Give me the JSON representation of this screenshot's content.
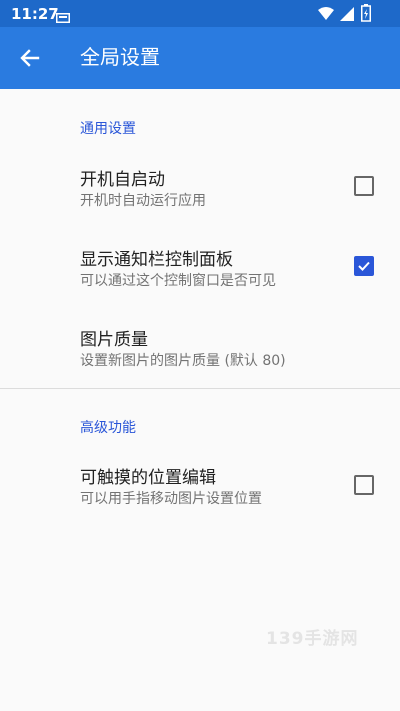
{
  "status_bar": {
    "time": "11:27",
    "icons": [
      "notification-icon",
      "wifi-icon",
      "signal-icon",
      "battery-icon"
    ]
  },
  "app_bar": {
    "title": "全局设置",
    "back_icon": "arrow-left-icon"
  },
  "sections": [
    {
      "header": "通用设置",
      "items": [
        {
          "title": "开机自启动",
          "summary": "开机时自动运行应用",
          "checked": false
        },
        {
          "title": "显示通知栏控制面板",
          "summary": "可以通过这个控制窗口是否可见",
          "checked": true
        },
        {
          "title": "图片质量",
          "summary": "设置新图片的图片质量 (默认 80)"
        }
      ]
    },
    {
      "header": "高级功能",
      "items": [
        {
          "title": "可触摸的位置编辑",
          "summary": "可以用手指移动图片设置位置",
          "checked": false
        }
      ]
    }
  ],
  "watermark": "139手游网",
  "colors": {
    "status_bar": "#1e69c9",
    "app_bar": "#2a7be0",
    "accent": "#2a56d8",
    "background": "#fafafa"
  }
}
